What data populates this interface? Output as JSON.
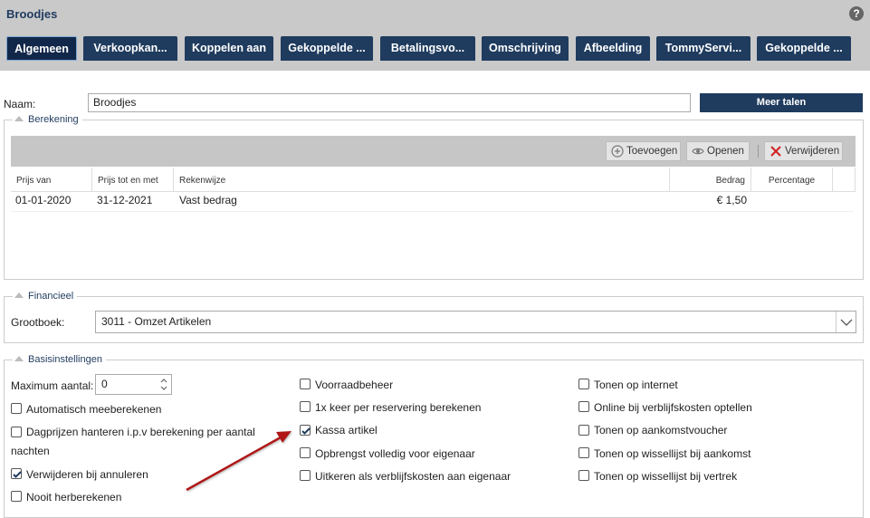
{
  "window": {
    "title": "Broodjes",
    "help_icon": "?"
  },
  "tabs": [
    {
      "label": "Algemeen",
      "active": true
    },
    {
      "label": "Verkoopkan..."
    },
    {
      "label": "Koppelen aan"
    },
    {
      "label": "Gekoppelde ..."
    },
    {
      "label": "Betalingsvo..."
    },
    {
      "label": "Omschrijving"
    },
    {
      "label": "Afbeelding"
    },
    {
      "label": "TommyServi..."
    },
    {
      "label": "Gekoppelde ..."
    }
  ],
  "naam": {
    "label": "Naam:",
    "value": "Broodjes",
    "meer_talen": "Meer talen"
  },
  "berekening": {
    "legend": "Berekening",
    "toolbar": {
      "add": "Toevoegen",
      "open": "Openen",
      "delete": "Verwijderen"
    },
    "columns": [
      "Prijs van",
      "Prijs tot en met",
      "Rekenwijze",
      "Bedrag",
      "Percentage"
    ],
    "rows": [
      {
        "van": "01-01-2020",
        "tot": "31-12-2021",
        "rekenwijze": "Vast bedrag",
        "bedrag": "€ 1,50",
        "percentage": ""
      }
    ]
  },
  "financieel": {
    "legend": "Financieel",
    "grootboek_label": "Grootboek:",
    "grootboek_value": "3011 - Omzet Artikelen"
  },
  "basis": {
    "legend": "Basisinstellingen",
    "max_label": "Maximum aantal:",
    "max_value": "0",
    "col1": [
      {
        "label": "Automatisch meeberekenen",
        "checked": false
      },
      {
        "label": "Dagprijzen hanteren i.p.v berekening per aantal",
        "label2": "nachten",
        "checked": false
      },
      {
        "label": "Verwijderen bij annuleren",
        "checked": true
      },
      {
        "label": "Nooit herberekenen",
        "checked": false
      }
    ],
    "col2": [
      {
        "label": "Voorraadbeheer",
        "checked": false
      },
      {
        "label": "1x keer per reservering berekenen",
        "checked": false
      },
      {
        "label": "Kassa artikel",
        "checked": true
      },
      {
        "label": "Opbrengst volledig voor eigenaar",
        "checked": false
      },
      {
        "label": "Uitkeren als verblijfskosten aan eigenaar",
        "checked": false
      }
    ],
    "col3": [
      {
        "label": "Tonen op internet",
        "checked": false
      },
      {
        "label": "Online bij verblijfskosten optellen",
        "checked": false
      },
      {
        "label": "Tonen op aankomstvoucher",
        "checked": false
      },
      {
        "label": "Tonen op wissellijst bij aankomst",
        "checked": false
      },
      {
        "label": "Tonen op wissellijst bij vertrek",
        "checked": false
      }
    ]
  },
  "colors": {
    "navy": "#1f3b5e",
    "arrow": "#b01818"
  }
}
